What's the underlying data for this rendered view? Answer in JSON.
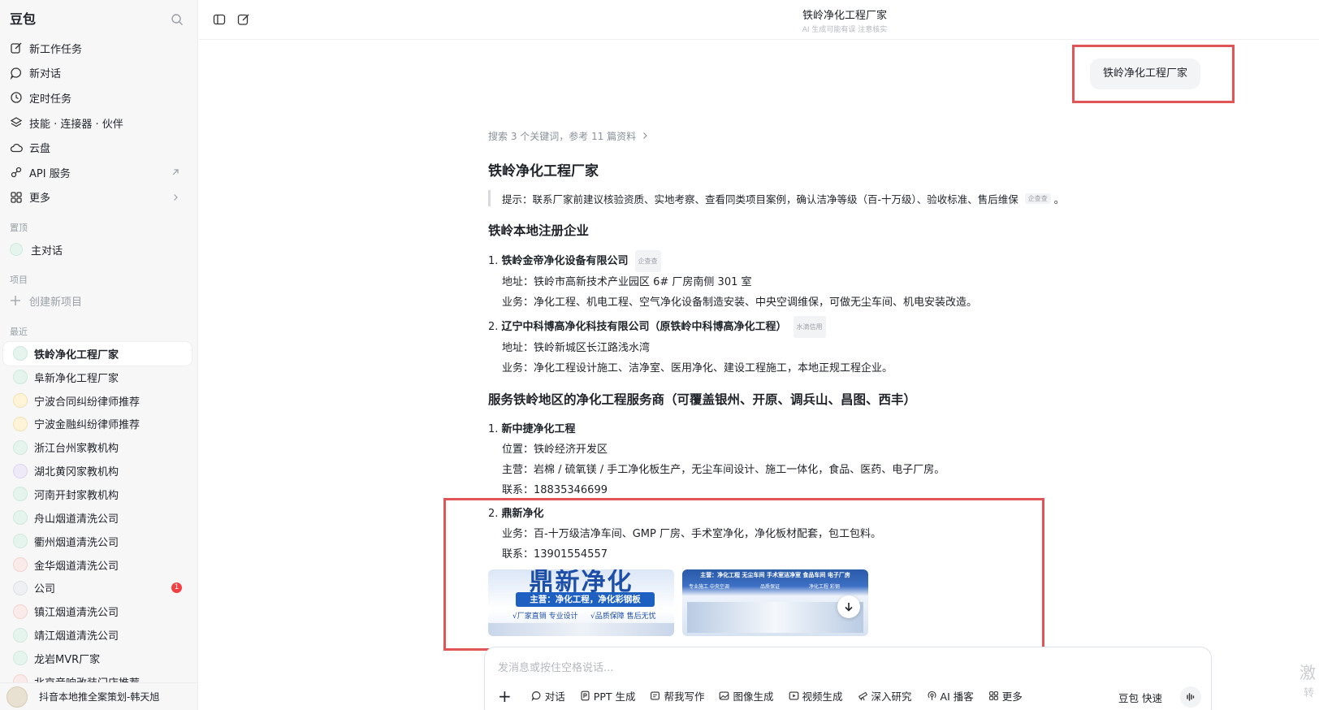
{
  "sidebar": {
    "brand": "豆包",
    "menu": [
      {
        "label": "新工作任务",
        "icon": "edit-icon"
      },
      {
        "label": "新对话",
        "icon": "chat-bubble-icon"
      },
      {
        "label": "定时任务",
        "icon": "clock-icon"
      },
      {
        "label": "技能 · 连接器 · 伙伴",
        "icon": "layers-icon"
      },
      {
        "label": "云盘",
        "icon": "cloud-icon"
      },
      {
        "label": "API 服务",
        "icon": "api-link-icon",
        "trail": "arrow-up-right-icon"
      },
      {
        "label": "更多",
        "icon": "grid-icon",
        "trail": "chevron-right-icon"
      }
    ],
    "pinned_label": "置顶",
    "pinned_item": "主对话",
    "project_label": "项目",
    "project_create": "创建新项目",
    "recent_label": "最近",
    "recent": [
      "铁岭净化工程厂家",
      "阜新净化工程厂家",
      "宁波合同纠纷律师推荐",
      "宁波金融纠纷律师推荐",
      "浙江台州家教机构",
      "湖北黄冈家教机构",
      "河南开封家教机构",
      "舟山烟道清洗公司",
      "衢州烟道清洗公司",
      "金华烟道清洗公司",
      "公司",
      "镇江烟道清洗公司",
      "靖江烟道清洗公司",
      "龙岩MVR厂家",
      "北京音响改装门店推荐"
    ],
    "recent_badge": "1",
    "footer_text": "抖音本地推全案策划-韩天旭"
  },
  "header": {
    "title": "铁岭净化工程厂家",
    "subtitle": "AI 生成可能有误 注意核实"
  },
  "user_message": "铁岭净化工程厂家",
  "answer": {
    "search_meta": "搜索 3 个关键词，参考 11 篇资料",
    "title": "铁岭净化工程厂家",
    "tip": "提示：联系厂家前建议核验资质、实地考察、查看同类项目案例，确认洁净等级（百-十万级）、验收标准、售后维保",
    "tip_cite": "企查查",
    "section1": "铁岭本地注册企业",
    "s1_items": [
      {
        "num": "1.",
        "name": "铁岭金帝净化设备有限公司",
        "cite": "企查查",
        "lines": [
          "地址：铁岭市高新技术产业园区 6# 厂房南侧 301 室",
          "业务：净化工程、机电工程、空气净化设备制造安装、中央空调维保，可做无尘车间、机电安装改造。"
        ]
      },
      {
        "num": "2.",
        "name": "辽宁中科博高净化科技有限公司（原铁岭中科博高净化工程）",
        "cite": "水滴信用",
        "lines": [
          "地址：铁岭新城区长江路浅水湾",
          "业务：净化工程设计施工、洁净室、医用净化、建设工程施工，本地正规工程企业。"
        ]
      }
    ],
    "section2": "服务铁岭地区的净化工程服务商（可覆盖银州、开原、调兵山、昌图、西丰）",
    "s2_items": [
      {
        "num": "1.",
        "name": "新中捷净化工程",
        "lines": [
          "位置：铁岭经济开发区",
          "主营：岩棉 / 硫氧镁 / 手工净化板生产，无尘车间设计、施工一体化，食品、医药、电子厂房。",
          "联系：18835346699"
        ]
      },
      {
        "num": "2.",
        "name": "鼎新净化",
        "lines": [
          "业务：百-十万级洁净车间、GMP 厂房、手术室净化，净化板材配套，包工包料。",
          "联系：13901554557"
        ]
      }
    ],
    "thumb1": {
      "big": "鼎新净化",
      "sub": "主营：净化工程，净化彩钢板",
      "foot1": "√厂家直销 专业设计",
      "foot2": "√品质保障 售后无忧"
    },
    "thumb2": {
      "banner": "主营：净化工程 无尘车间 手术室洁净室 食品车间 电子厂房",
      "f1": "专业施工 中央空调",
      "f2": "品质保证",
      "f3": "净化工程 彩钢"
    }
  },
  "composer": {
    "placeholder": "发消息或按住空格说话...",
    "tools": [
      {
        "label": "对话",
        "icon": "chat-bubble-icon"
      },
      {
        "label": "PPT 生成",
        "icon": "ppt-icon"
      },
      {
        "label": "帮我写作",
        "icon": "write-icon"
      },
      {
        "label": "图像生成",
        "icon": "image-icon"
      },
      {
        "label": "视频生成",
        "icon": "video-icon"
      },
      {
        "label": "深入研究",
        "icon": "telescope-icon"
      },
      {
        "label": "AI 播客",
        "icon": "podcast-icon"
      },
      {
        "label": "更多",
        "icon": "grid-icon"
      }
    ],
    "mode": "豆包 快速"
  },
  "watermark": {
    "line1": "激",
    "line2": "转"
  },
  "colors": {
    "accent_red": "#e05555",
    "badge": "#f23f43",
    "sidebar_bg": "#f7f7f8"
  }
}
